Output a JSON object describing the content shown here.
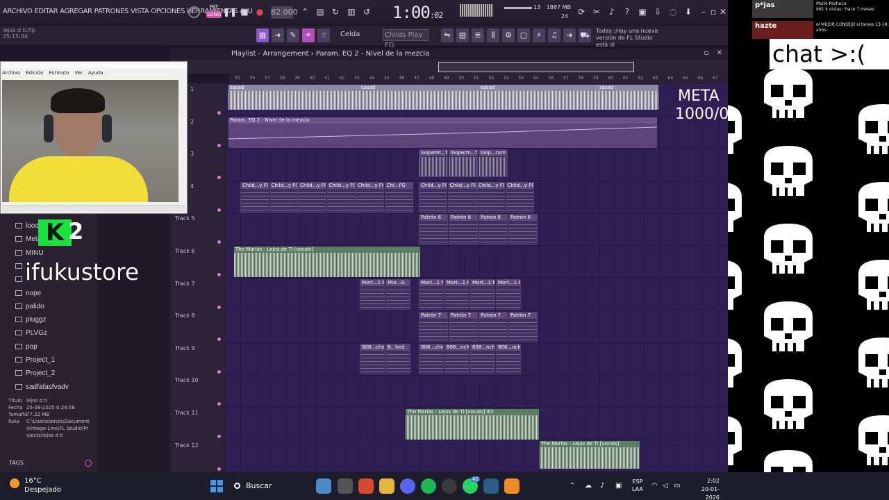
{
  "menu": [
    "ARCHIVO",
    "EDITAR",
    "AGREGAR",
    "PATRONES",
    "VISTA",
    "OPCIONES",
    "HERRAMIENTAS",
    "AYU"
  ],
  "transport": {
    "pat_label": "PAT",
    "song_label": "SONG",
    "tempo": "82.000",
    "time_main": "1:00",
    "time_sub": ":02"
  },
  "stats": {
    "cpu_num": "13",
    "memory": "1887 MB",
    "polyphony": "24"
  },
  "song_info": {
    "name": "lejos d ti.flp",
    "time": "25:15:04"
  },
  "snap": "Celda",
  "pattern_selector": "Childs Play FG",
  "news": "Today ¡Hay una nueva versión de FL Studio está di",
  "playlist": {
    "title": "Playlist - Arrangement › Param. EQ 2 - Nivel de la mezcla",
    "ruler_marks": [
      "35",
      "36",
      "37",
      "38",
      "39",
      "40",
      "41",
      "42",
      "43",
      "44",
      "45",
      "46",
      "47",
      "48",
      "49",
      "50",
      "51",
      "52",
      "53",
      "54",
      "55",
      "56",
      "57",
      "58",
      "59",
      "60",
      "61",
      "62",
      "63",
      "64",
      "65",
      "66",
      "67"
    ],
    "tracks": [
      "1",
      "2",
      "3",
      "4",
      "Track 5",
      "Track 6",
      "Track 7",
      "Track 8",
      "Track 9",
      "Track 10",
      "Track 11",
      "Track 12"
    ],
    "clips": {
      "t1": [
        "sasad",
        "sasad",
        "sasad",
        "sasad"
      ],
      "t2": "Param. EQ 2 - Nivel de la mezcla",
      "t3": [
        "looperm...fi-drum",
        "looperm...fi-drum",
        "loop...rum"
      ],
      "t4": [
        "Child...y FG",
        "Child...y FG",
        "Child...y FG",
        "Child...y FG",
        "Child...y FG",
        "Chi...FG",
        "Child...y FG",
        "Child...y FG",
        "Child...y FG",
        "Child...y FG"
      ],
      "t5": [
        "Patrón 6",
        "Patrón 6",
        "Patrón 6",
        "Patrón 6"
      ],
      "t6": "The Marías - Lejos de Ti [vocals]",
      "t7": [
        "Mort...1 FG",
        "Mor...G",
        "Mort...1 FG",
        "Mort...1 FG",
        "Mort...1 FG",
        "Mort...1 FG"
      ],
      "t8": [
        "Patrón 7",
        "Patrón 7",
        "Patrón 7",
        "Patrón 7"
      ],
      "t9": [
        "808...ched",
        "8...hed",
        "808...ched",
        "808...nched",
        "808...nched",
        "808...nched"
      ],
      "t11": "The Marías - Lejos de Ti [vocals] #2",
      "t12": "The Marías - Lejos de Ti [vocals]"
    }
  },
  "overlay": {
    "meta_line1": "META",
    "meta_line2": "1000/0",
    "k_letter": "K",
    "k_num": "2",
    "store": "ifukustore",
    "chat": "chat >:("
  },
  "notepad_menu": [
    "Archivo",
    "Edición",
    "Formato",
    "Ver",
    "Ayuda"
  ],
  "browser": {
    "folders": [
      "looo",
      "Meta",
      "MINU",
      "",
      "",
      "nope",
      "palido",
      "pluggz",
      "PLVGz",
      "pop",
      "Project_1",
      "Project_2",
      "sadfafasfvadv"
    ],
    "info_labels": [
      "Título",
      "Fecha",
      "Tamaño",
      "Ruta"
    ],
    "info_values": [
      "lejos d ti",
      "25-08-2025 0:24:56",
      "77.22 MB",
      "C:\\Users\\kenzo\\Documents\\Image-Line\\FL Studio\\Projects\\lejos d ti"
    ],
    "tags": "TAGS"
  },
  "youtube": [
    {
      "thumb": "p*jas",
      "channel": "Morlo Pacheco",
      "meta": "661 k vistas · hace 7 meses",
      "duration": "8:16"
    },
    {
      "thumb": "hazte",
      "title": "el MEJOR CONSEJO si tienes 13-18 años."
    }
  ],
  "taskbar": {
    "temp": "16°C",
    "weather": "Despejado",
    "search": "Buscar",
    "lang1": "ESP",
    "lang2": "LAA",
    "time": "2:02",
    "date": "20-01-2026",
    "badge": "42"
  },
  "colors": {
    "playlist_bg": "#2f1f52",
    "k_green": "#18e23c",
    "song_pink": "#d34ea8"
  }
}
